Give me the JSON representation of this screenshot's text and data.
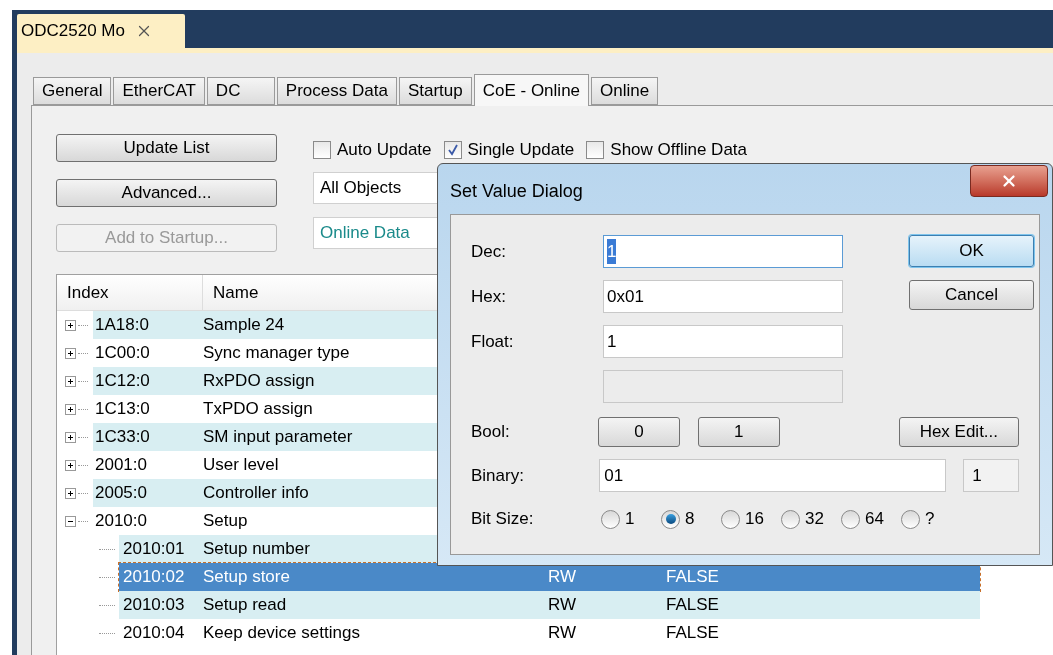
{
  "document_tab": {
    "title": "ODC2520 Mo"
  },
  "tabs": [
    {
      "label": "General",
      "selected": false
    },
    {
      "label": "EtherCAT",
      "selected": false
    },
    {
      "label": "DC",
      "selected": false
    },
    {
      "label": "Process Data",
      "selected": false
    },
    {
      "label": "Startup",
      "selected": false
    },
    {
      "label": "CoE - Online",
      "selected": true
    },
    {
      "label": "Online",
      "selected": false
    }
  ],
  "buttons": [
    {
      "label": "Update List",
      "disabled": false
    },
    {
      "label": "Advanced...",
      "disabled": false
    },
    {
      "label": "Add to Startup...",
      "disabled": true
    }
  ],
  "checkboxes": [
    {
      "label": "Auto Update",
      "checked": false
    },
    {
      "label": "Single Update",
      "checked": true
    },
    {
      "label": "Show Offline Data",
      "checked": false
    }
  ],
  "object_filter": {
    "value": "All Objects"
  },
  "data_source": {
    "value": "Online Data"
  },
  "table": {
    "columns": [
      "Index",
      "Name"
    ],
    "rows": [
      {
        "index": "1A18:0",
        "name": "Sample 24",
        "expanded": false,
        "selected": false
      },
      {
        "index": "1C00:0",
        "name": "Sync manager type",
        "expanded": false,
        "selected": false
      },
      {
        "index": "1C12:0",
        "name": "RxPDO assign",
        "expanded": false,
        "selected": false
      },
      {
        "index": "1C13:0",
        "name": "TxPDO assign",
        "expanded": false,
        "selected": false
      },
      {
        "index": "1C33:0",
        "name": "SM input parameter",
        "expanded": false,
        "selected": false
      },
      {
        "index": "2001:0",
        "name": "User level",
        "expanded": false,
        "selected": false
      },
      {
        "index": "2005:0",
        "name": "Controller info",
        "expanded": false,
        "selected": false
      },
      {
        "index": "2010:0",
        "name": "Setup",
        "expanded": true,
        "selected": false,
        "children": [
          {
            "index": "2010:01",
            "name": "Setup number",
            "selected": false
          },
          {
            "index": "2010:02",
            "name": "Setup store",
            "flags": "RW",
            "value": "FALSE",
            "selected": true
          },
          {
            "index": "2010:03",
            "name": "Setup read",
            "flags": "RW",
            "value": "FALSE",
            "selected": false
          },
          {
            "index": "2010:04",
            "name": "Keep device settings",
            "flags": "RW",
            "value": "FALSE",
            "selected": false
          }
        ]
      }
    ]
  },
  "dialog": {
    "title": "Set Value Dialog",
    "dec": {
      "label": "Dec:",
      "value": "1"
    },
    "hex": {
      "label": "Hex:",
      "value": "0x01"
    },
    "float": {
      "label": "Float:",
      "value": "1"
    },
    "bool": {
      "label": "Bool:",
      "buttons": [
        "0",
        "1"
      ]
    },
    "hex_edit": "Hex Edit...",
    "ok": "OK",
    "cancel": "Cancel",
    "binary": {
      "label": "Binary:",
      "value": "01",
      "length": "1"
    },
    "bit_size": {
      "label": "Bit Size:",
      "options": [
        {
          "label": "1",
          "selected": false
        },
        {
          "label": "8",
          "selected": true
        },
        {
          "label": "16",
          "selected": false
        },
        {
          "label": "32",
          "selected": false
        },
        {
          "label": "64",
          "selected": false
        },
        {
          "label": "?",
          "selected": false
        }
      ]
    }
  }
}
